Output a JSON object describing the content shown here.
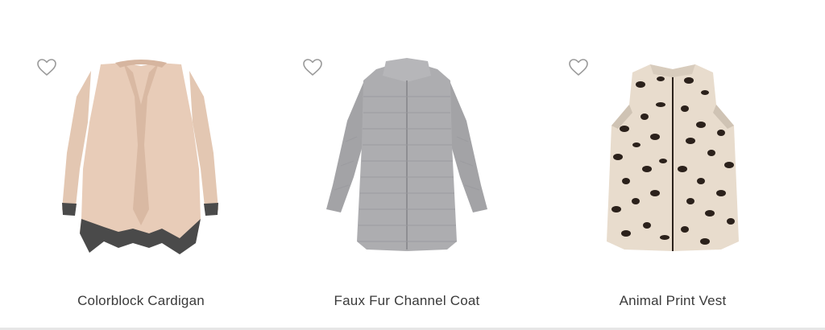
{
  "products": [
    {
      "name": "Colorblock Cardigan",
      "favorite_icon": "heart-outline-icon"
    },
    {
      "name": "Faux Fur Channel Coat",
      "favorite_icon": "heart-outline-icon"
    },
    {
      "name": "Animal Print Vest",
      "favorite_icon": "heart-outline-icon"
    }
  ],
  "colors": {
    "heart_outline": "#9a9a9a",
    "product_name_text": "#3a3a3a",
    "cardigan_body": "#e6cbb7",
    "cardigan_trim": "#4a4a4a",
    "coat_body": "#a9a9ab",
    "vest_base": "#e8dccd",
    "vest_spots": "#2b211b"
  }
}
